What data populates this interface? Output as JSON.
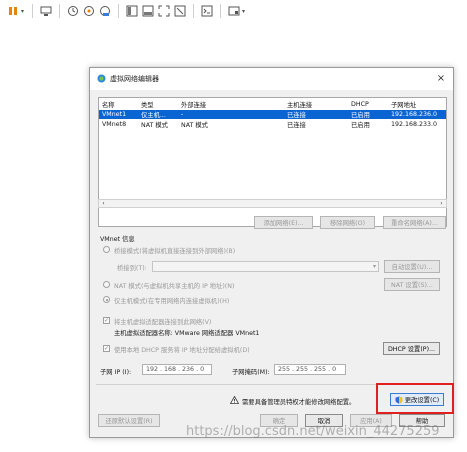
{
  "toolbar": {
    "icons": [
      "pause-icon",
      "send-keys-icon",
      "snapshot-icon",
      "snapshot-restore-icon",
      "snapshot-manager-icon",
      "full-screen-icon",
      "console-view-icon",
      "unity-icon",
      "stretch-icon",
      "terminal-icon",
      "view-icon"
    ]
  },
  "dialog": {
    "title": "虚拟网络编辑器",
    "close_glyph": "×",
    "table": {
      "headers": [
        "名称",
        "类型",
        "外部连接",
        "主机连接",
        "DHCP",
        "子网地址"
      ],
      "rows": [
        {
          "name": "VMnet1",
          "type": "仅主机...",
          "external": "-",
          "host": "已连接",
          "dhcp": "已启用",
          "subnet": "192.168.236.0",
          "selected": true
        },
        {
          "name": "VMnet8",
          "type": "NAT 模式",
          "external": "NAT 模式",
          "host": "已连接",
          "dhcp": "已启用",
          "subnet": "192.168.233.0",
          "selected": false
        }
      ]
    },
    "table_buttons": {
      "add": "添加网络(E)...",
      "remove": "移除网络(O)",
      "rename": "重命名网络(A)..."
    },
    "vmnet_info_label": "VMnet 信息",
    "bridged": {
      "label": "桥接模式(将虚拟机直接连接到外部网络)(B)",
      "bridged_to_label": "桥接到(T):",
      "auto_button": "自动设置(U)..."
    },
    "nat": {
      "label": "NAT 模式(与虚拟机共享主机的 IP 地址)(N)",
      "settings_button": "NAT 设置(S)..."
    },
    "host_only": {
      "label": "仅主机模式(在专用网络内连接虚拟机)(H)"
    },
    "host_adapter": {
      "label": "将主机虚拟适配器连接到此网络(V)",
      "adapter_name": "主机虚拟适配器名称: VMware 网络适配器 VMnet1"
    },
    "dhcp": {
      "label": "使用本地 DHCP 服务将 IP 地址分配给虚拟机(D)",
      "settings_button": "DHCP 设置(P)..."
    },
    "subnet": {
      "ip_label": "子网 IP (I):",
      "ip_value": "192 . 168 . 236 .  0",
      "mask_label": "子网掩码(M):",
      "mask_value": "255 . 255 . 255 .  0"
    },
    "admin_notice": "需要具备管理员特权才能修改网络配置。",
    "change_settings_button": "更改设置(C)",
    "footer": {
      "restore_defaults": "还原默认设置(R)",
      "ok": "确定",
      "cancel": "取消",
      "apply": "应用(A)",
      "help": "帮助"
    },
    "checkbox_glyph": "✓"
  },
  "watermark": "https://blog.csdn.net/weixin_44275259",
  "colors": {
    "accent": "#0a64d2",
    "highlight_box": "#e02020",
    "pause_orange": "#e8830c"
  }
}
